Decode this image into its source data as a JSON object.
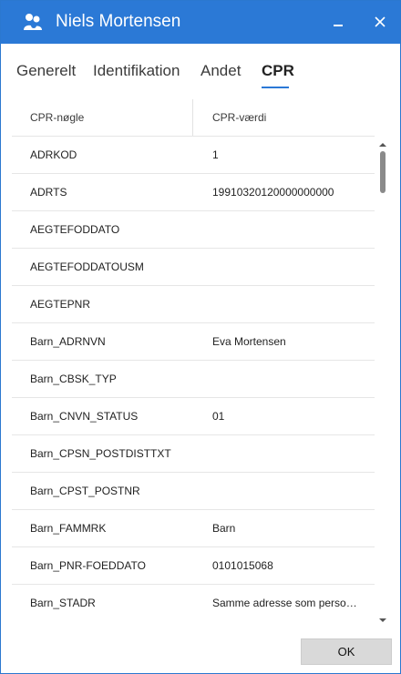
{
  "window": {
    "title": "Niels Mortensen",
    "accent_color": "#2b79d6"
  },
  "tabs": [
    {
      "label": "Generelt",
      "active": false
    },
    {
      "label": "Identifikation",
      "active": false
    },
    {
      "label": "Andet",
      "active": false
    },
    {
      "label": "CPR",
      "active": true
    }
  ],
  "grid": {
    "columns": [
      "CPR-nøgle",
      "CPR-værdi"
    ],
    "rows": [
      {
        "key": "ADRKOD",
        "value": "1"
      },
      {
        "key": "ADRTS",
        "value": "19910320120000000000"
      },
      {
        "key": "AEGTEFODDATO",
        "value": ""
      },
      {
        "key": "AEGTEFODDATOUSM",
        "value": ""
      },
      {
        "key": "AEGTEPNR",
        "value": ""
      },
      {
        "key": "Barn_ADRNVN",
        "value": "Eva Mortensen"
      },
      {
        "key": "Barn_CBSK_TYP",
        "value": ""
      },
      {
        "key": "Barn_CNVN_STATUS",
        "value": "01"
      },
      {
        "key": "Barn_CPSN_POSTDISTTXT",
        "value": ""
      },
      {
        "key": "Barn_CPST_POSTNR",
        "value": ""
      },
      {
        "key": "Barn_FAMMRK",
        "value": "Barn"
      },
      {
        "key": "Barn_PNR-FOEDDATO",
        "value": "0101015068"
      },
      {
        "key": "Barn_STADR",
        "value": "Samme adresse som person..."
      }
    ]
  },
  "footer": {
    "ok_label": "OK"
  },
  "icons": {
    "app": "people-icon",
    "minimize": "minimize-icon",
    "close": "close-icon",
    "scroll_up": "chevron-up-icon",
    "scroll_down": "chevron-down-icon"
  }
}
